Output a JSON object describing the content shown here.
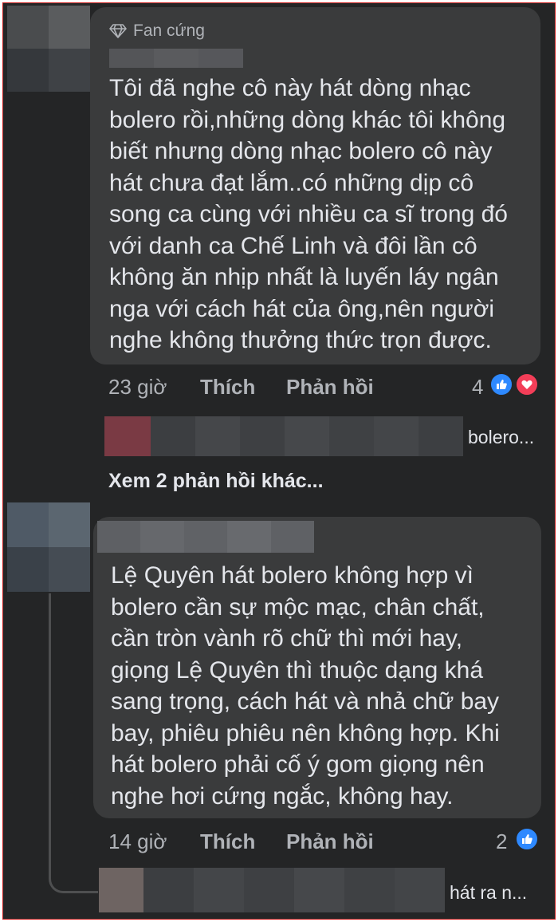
{
  "comments": [
    {
      "badge": "Fan cứng",
      "badge_icon": "diamond-icon",
      "text": "Tôi đã nghe cô này hát dòng nhạc\nbolero rồi,những dòng khác tôi không\nbiết nhưng dòng nhạc bolero cô này\nhát chưa đạt lắm..có những dịp cô\nsong ca cùng với nhiều ca sĩ trong đó\nvới danh ca Chế Linh và đôi lần cô\nkhông ăn nhịp nhất là luyến láy ngân\nnga với cách hát của ông,nên người\nnghe không thưởng thức trọn được.",
      "time": "23 giờ",
      "like_label": "Thích",
      "reply_label": "Phản hồi",
      "reaction_count": "4",
      "reactions": [
        "like-icon",
        "love-icon"
      ],
      "reply_preview": "bolero...",
      "more_replies": "Xem 2 phản hồi khác..."
    },
    {
      "text": "Lệ Quyên hát bolero không hợp vì\nbolero cần sự mộc mạc, chân chất,\ncần tròn vành rõ chữ thì mới hay,\ngiọng Lệ Quyên thì thuộc dạng khá\nsang trọng, cách hát và nhả chữ bay\nbay, phiêu phiêu nên không hợp. Khi\nhát bolero phải cố ý gom giọng nên\nnghe hơi cứng ngắc, không hay.",
      "time": "14 giờ",
      "like_label": "Thích",
      "reply_label": "Phản hồi",
      "reaction_count": "2",
      "reactions": [
        "like-icon"
      ],
      "reply_preview": "hát ra n..."
    }
  ],
  "colors": {
    "background": "#242526",
    "bubble": "#3a3b3c",
    "text": "#e4e6eb",
    "secondary": "#b0b3b8",
    "like": "#2e89ff",
    "love": "#f33e58"
  }
}
